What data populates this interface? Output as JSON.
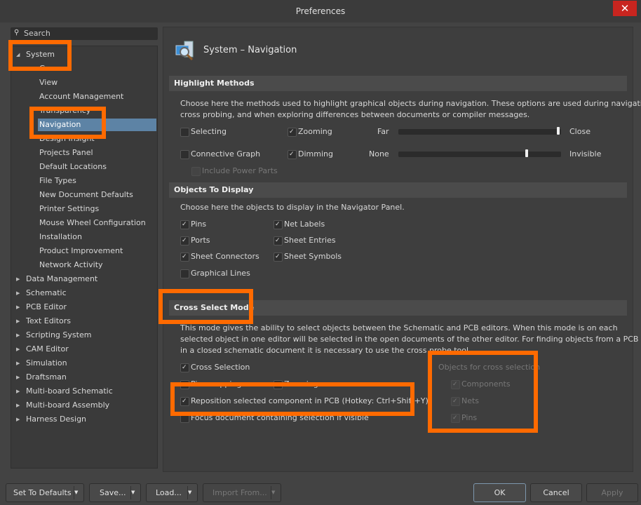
{
  "window": {
    "title": "Preferences",
    "close": "✕"
  },
  "search": {
    "placeholder": "Search",
    "icon": "🔍"
  },
  "tree": {
    "system": "System",
    "system_children": [
      "General",
      "View",
      "Account Management",
      "Transparency",
      "Navigation",
      "Design Insight",
      "Projects Panel",
      "Default Locations",
      "File Types",
      "New Document Defaults",
      "Printer Settings",
      "Mouse Wheel Configuration",
      "Installation",
      "Product Improvement",
      "Network Activity"
    ],
    "others": [
      "Data Management",
      "Schematic",
      "PCB Editor",
      "Text Editors",
      "Scripting System",
      "CAM Editor",
      "Simulation",
      "Draftsman",
      "Multi-board Schematic",
      "Multi-board Assembly",
      "Harness Design"
    ]
  },
  "page": {
    "title": "System – Navigation"
  },
  "highlight": {
    "header": "Highlight Methods",
    "desc1": "Choose here the methods used to highlight graphical objects during navigation. These options are used during navigation,",
    "desc2": "cross probing, and when exploring differences between documents or compiler messages.",
    "selecting": "Selecting",
    "zooming": "Zooming",
    "connective": "Connective Graph",
    "dimming": "Dimming",
    "power": "Include Power Parts",
    "far": "Far",
    "close": "Close",
    "none": "None",
    "invisible": "Invisible",
    "zoom_level": 1.0,
    "dim_level": 0.8
  },
  "objects": {
    "header": "Objects To Display",
    "desc": "Choose here the objects to display in the Navigator Panel.",
    "pins": "Pins",
    "net_labels": "Net Labels",
    "ports": "Ports",
    "sheet_entries": "Sheet Entries",
    "sheet_connectors": "Sheet Connectors",
    "sheet_symbols": "Sheet Symbols",
    "graphical_lines": "Graphical Lines"
  },
  "cross": {
    "header": "Cross Select Mode",
    "desc1": "This mode gives the ability to select objects between the Schematic and PCB editors.  When this mode is on each",
    "desc2": "selected object in one editor will be selected in the open documents of the other editor.  For finding objects from a PCB",
    "desc3": "in a closed schematic document it is necessary to use the cross probe tool.",
    "cross_selection": "Cross Selection",
    "pin_swapping": "Pin swapping",
    "zooming": "Zooming",
    "reposition": "Reposition selected component in PCB (Hotkey: Ctrl+Shift+Y)",
    "focus": "Focus document containing selection if visible",
    "group_title": "Objects for cross selection",
    "components": "Components",
    "nets": "Nets",
    "pins": "Pins"
  },
  "buttons": {
    "defaults": "Set To Defaults",
    "save": "Save...",
    "load": "Load...",
    "import": "Import From...",
    "ok": "OK",
    "cancel": "Cancel",
    "apply": "Apply",
    "dd": "▼"
  }
}
